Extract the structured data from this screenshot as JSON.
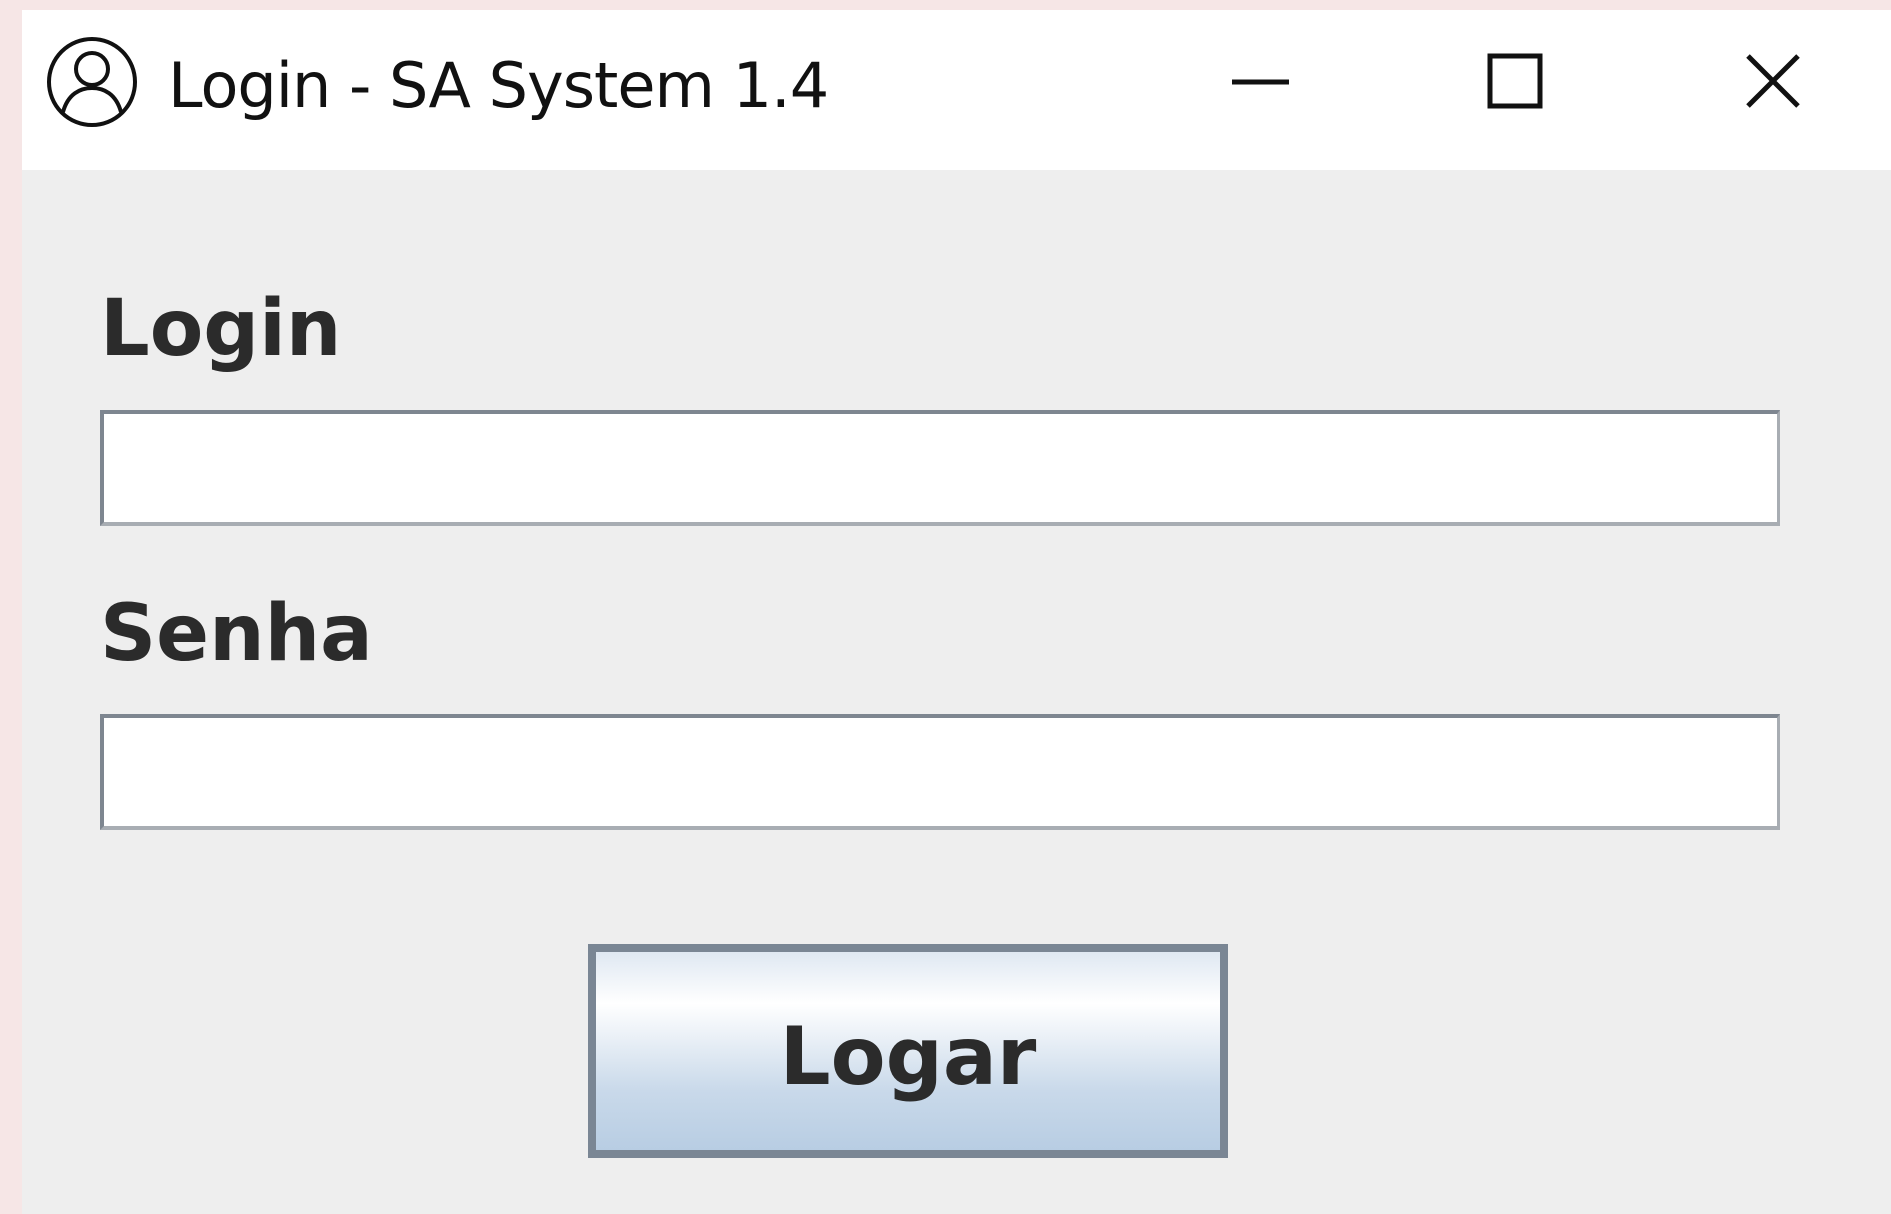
{
  "window": {
    "title": "Login - SA System 1.4",
    "icon": "user-circle-icon"
  },
  "titlebar": {
    "minimize_icon": "minimize-icon",
    "maximize_icon": "maximize-icon",
    "close_icon": "close-icon"
  },
  "form": {
    "login_label": "Login",
    "login_value": "",
    "password_label": "Senha",
    "password_value": "",
    "submit_label": "Logar"
  },
  "colors": {
    "background": "#eeeeee",
    "titlebar": "#ffffff",
    "button_border": "#7a8694",
    "button_gradient_bottom": "#b8cde3"
  }
}
